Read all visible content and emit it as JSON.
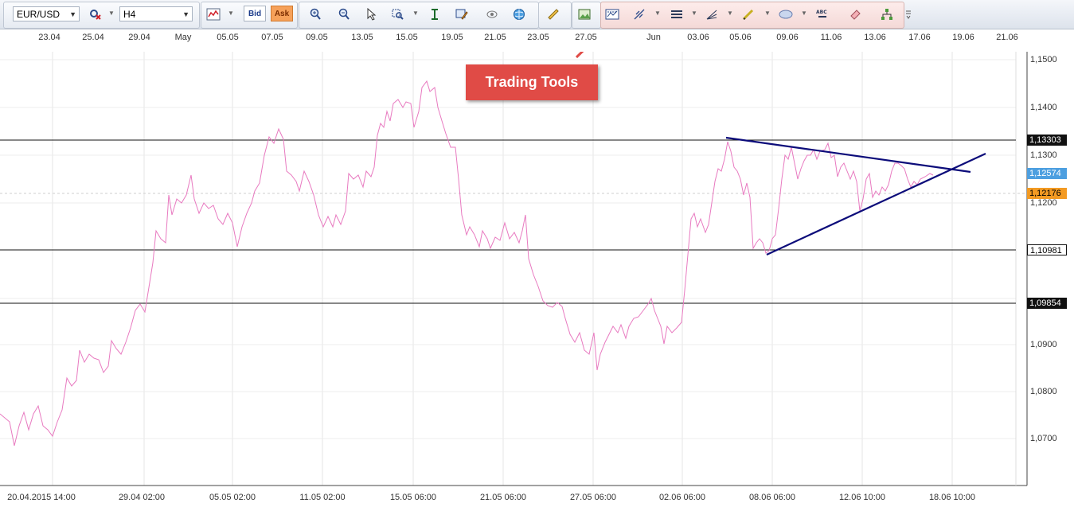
{
  "toolbar": {
    "symbol": "EUR/USD",
    "timeframe": "H4",
    "bid_label": "Bid",
    "ask_label": "Ask"
  },
  "top_dates": [
    "23.04",
    "25.04",
    "29.04",
    "May",
    "05.05",
    "07.05",
    "09.05",
    "13.05",
    "15.05",
    "19.05",
    "21.05",
    "23.05",
    "27.05",
    "Jun",
    "03.06",
    "05.06",
    "09.06",
    "11.06",
    "13.06",
    "17.06",
    "19.06",
    "21.06"
  ],
  "bottom_dates": [
    "20.04.2015 14:00",
    "29.04 02:00",
    "05.05 02:00",
    "11.05 02:00",
    "15.05 06:00",
    "21.05 06:00",
    "27.05 06:00",
    "02.06 06:00",
    "08.06 06:00",
    "12.06 10:00",
    "18.06 10:00"
  ],
  "price_ticks": [
    "1,1500",
    "1,1400",
    "1,1300",
    "1,1200",
    "1,0900",
    "1,0800",
    "1,0700"
  ],
  "price_badges": {
    "resistance": "1,13303",
    "ask": "1,12574",
    "bid": "1,12176",
    "support_1": "1,10981",
    "support_2": "1,09854"
  },
  "callout": "Trading Tools",
  "colors": {
    "price_line": "#e87ac0",
    "trendline": "#0c0c7a",
    "ask_badge": "#4d9fe0",
    "bid_badge": "#f39a22",
    "callout": "#e04b46"
  }
}
